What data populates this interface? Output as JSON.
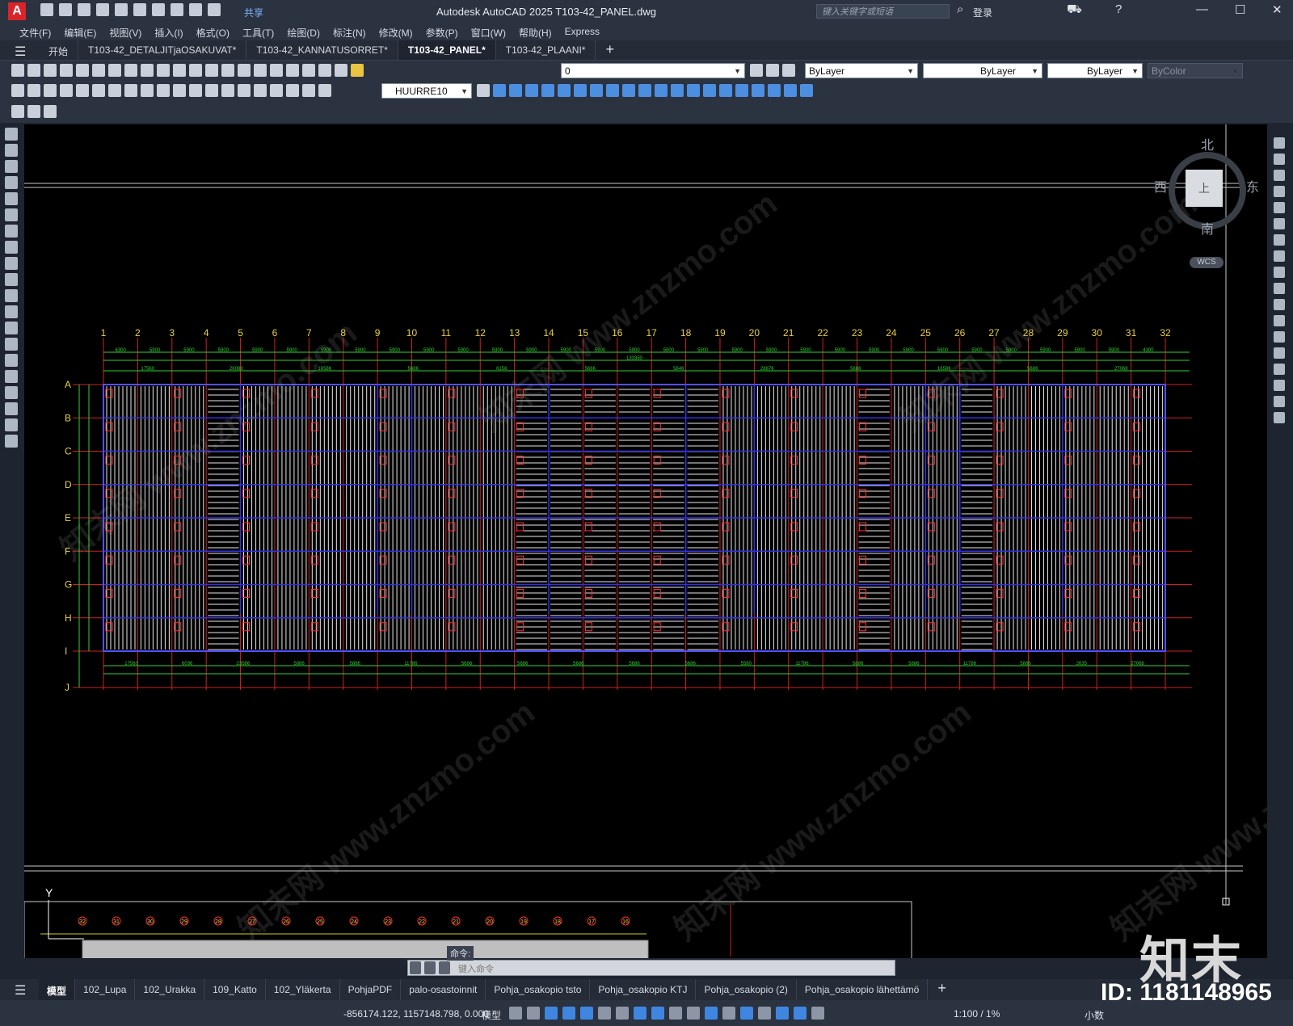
{
  "window": {
    "app_logo": "A",
    "title": "Autodesk AutoCAD 2025    T103-42_PANEL.dwg",
    "search_placeholder": "键入关键字或短语",
    "login": "登录",
    "share": "共享",
    "controls": [
      "—",
      "☐",
      "✕"
    ]
  },
  "menu": [
    "文件(F)",
    "编辑(E)",
    "视图(V)",
    "插入(I)",
    "格式(O)",
    "工具(T)",
    "绘图(D)",
    "标注(N)",
    "修改(M)",
    "参数(P)",
    "窗口(W)",
    "帮助(H)",
    "Express"
  ],
  "doc_tabs": [
    {
      "label": "开始",
      "active": false
    },
    {
      "label": "T103-42_DETALJITjaOSAKUVAT*",
      "active": false
    },
    {
      "label": "T103-42_KANNATUSORRET*",
      "active": false
    },
    {
      "label": "T103-42_PANEL*",
      "active": true
    },
    {
      "label": "T103-42_PLAANI*",
      "active": false
    }
  ],
  "properties": {
    "layer": "0",
    "color": "ByLayer",
    "linetype": "ByLayer",
    "lineweight": "ByLayer",
    "plotstyle": "ByColor",
    "dimstyle": "HUURRE10"
  },
  "viewcube": {
    "north": "北",
    "south": "南",
    "east": "东",
    "west": "西",
    "face": "上",
    "wcs": "WCS"
  },
  "drawing": {
    "column_labels": [
      "1",
      "2",
      "3",
      "4",
      "5",
      "6",
      "7",
      "8",
      "9",
      "10",
      "11",
      "12",
      "13",
      "14",
      "15",
      "16",
      "17",
      "18",
      "19",
      "20",
      "21",
      "22",
      "23",
      "24",
      "25",
      "26",
      "27",
      "28",
      "29",
      "30",
      "31",
      "32"
    ],
    "row_labels": [
      "A",
      "B",
      "C",
      "D",
      "E",
      "F",
      "G",
      "H",
      "I",
      "J"
    ],
    "overall_dim": "133350",
    "bay_dims": [
      "6300",
      "5900",
      "5900",
      "5900",
      "5900",
      "5900",
      "5900",
      "5900",
      "5900",
      "5900",
      "5900",
      "5900",
      "5900",
      "5900",
      "5900",
      "5900",
      "5900",
      "5900",
      "5900",
      "5900",
      "5900",
      "5900",
      "5900",
      "5900",
      "5900",
      "5900",
      "5900",
      "5900",
      "5900",
      "5900",
      "4300"
    ],
    "top_segment_dims": [
      "17560",
      "26088",
      "16586",
      "5686",
      "6156",
      "5686",
      "5646",
      "28676",
      "5686",
      "16586",
      "5686",
      "27068"
    ],
    "bottom_segment_dims": [
      "17560",
      "6036",
      "23586",
      "5886",
      "5886",
      "11786",
      "5686",
      "5686",
      "5686",
      "5686",
      "5686",
      "5580",
      "11786",
      "5886",
      "5886",
      "11786",
      "5886",
      "2635",
      "27068"
    ],
    "mini_labels": [
      "32",
      "31",
      "30",
      "29",
      "28",
      "27",
      "26",
      "25",
      "24",
      "23",
      "22",
      "21",
      "20",
      "19",
      "18",
      "17",
      "16"
    ],
    "ucs_y": "Y"
  },
  "command_line": {
    "tag": "命令:",
    "prompt": "键入命令"
  },
  "layout_tabs": [
    {
      "label": "模型",
      "active": true
    },
    {
      "label": "102_Lupa",
      "active": false
    },
    {
      "label": "102_Urakka",
      "active": false
    },
    {
      "label": "109_Katto",
      "active": false
    },
    {
      "label": "102_Yläkerta",
      "active": false
    },
    {
      "label": "PohjaPDF",
      "active": false
    },
    {
      "label": "palo-osastoinnit",
      "active": false
    },
    {
      "label": "Pohja_osakopio tsto",
      "active": false
    },
    {
      "label": "Pohja_osakopio KTJ",
      "active": false
    },
    {
      "label": "Pohja_osakopio (2)",
      "active": false
    },
    {
      "label": "Pohja_osakopio lähettämö",
      "active": false
    }
  ],
  "status": {
    "coords": "-856174.122, 1157148.798, 0.000",
    "mode": "模型",
    "scale": "1:100 / 1%",
    "units": "小数"
  },
  "brand": {
    "text": "知末",
    "id": "ID: 1181148965"
  }
}
